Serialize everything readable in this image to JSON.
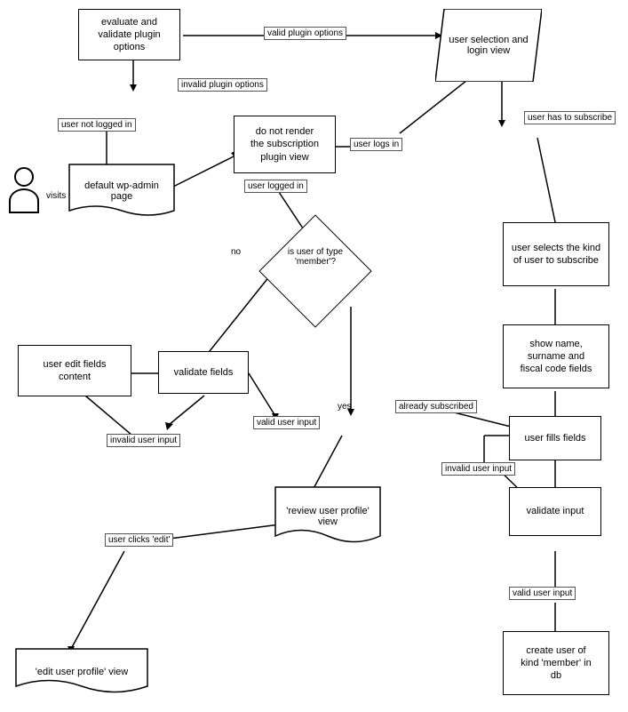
{
  "nodes": {
    "evaluate": {
      "label": "evaluate and\nvalidate plugin\noptions"
    },
    "valid_plugin_options": {
      "label": "valid plugin options"
    },
    "user_selection_login": {
      "label": "user selection and\nlogin view"
    },
    "invalid_plugin_options": {
      "label": "invalid plugin options"
    },
    "user_not_logged_in": {
      "label": "user not logged in"
    },
    "do_not_render": {
      "label": "do not render\nthe subscription\nplugin view"
    },
    "user_logs_in": {
      "label": "user logs in"
    },
    "user_has_to_subscribe": {
      "label": "user has to subscribe"
    },
    "default_wpadmin": {
      "label": "default wp-admin\npage"
    },
    "visits": {
      "label": "visits"
    },
    "user_logged_in": {
      "label": "user logged in"
    },
    "user_selects_kind": {
      "label": "user selects the kind\nof user to subscribe"
    },
    "is_member_diamond": {
      "label": "is user of type\n'member'?"
    },
    "no_label": {
      "label": "no"
    },
    "yes_label": {
      "label": "yes"
    },
    "user_edit_fields": {
      "label": "user edit fields\ncontent"
    },
    "validate_fields": {
      "label": "validate fields"
    },
    "show_name_surname": {
      "label": "show name,\nsurname and\nfiscal code fields"
    },
    "invalid_user_input_left": {
      "label": "invalid user input"
    },
    "valid_user_input": {
      "label": "valid user input"
    },
    "already_subscribed": {
      "label": "already subscribed"
    },
    "user_fills_fields": {
      "label": "user fills fields"
    },
    "invalid_user_input_right": {
      "label": "invalid user input"
    },
    "review_user_profile": {
      "label": "'review user profile'\nview"
    },
    "validate_input": {
      "label": "validate input"
    },
    "user_clicks_edit": {
      "label": "user clicks 'edit'"
    },
    "valid_user_input_right": {
      "label": "valid user input"
    },
    "edit_user_profile": {
      "label": "'edit user profile' view"
    },
    "create_user_member": {
      "label": "create user of\nkind 'member' in\ndb"
    }
  }
}
